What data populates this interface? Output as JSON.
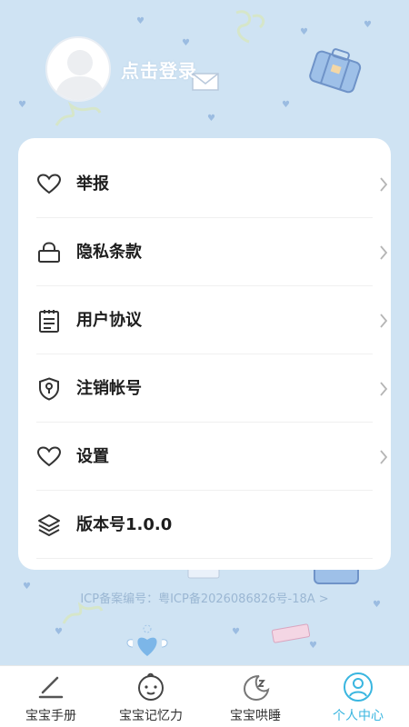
{
  "header": {
    "login_text": "点击登录"
  },
  "menu": {
    "items": [
      {
        "label": "举报",
        "icon": "heart-icon",
        "chevron": true
      },
      {
        "label": "隐私条款",
        "icon": "lock-icon",
        "chevron": true
      },
      {
        "label": "用户协议",
        "icon": "clipboard-icon",
        "chevron": true
      },
      {
        "label": "注销帐号",
        "icon": "shield-icon",
        "chevron": true
      },
      {
        "label": "设置",
        "icon": "heart-icon",
        "chevron": true
      },
      {
        "label": "版本号1.0.0",
        "icon": "layers-icon",
        "chevron": false
      }
    ]
  },
  "footer": {
    "icp": "ICP备案编号：粤ICP备2026086826号-18A >"
  },
  "tabbar": {
    "tabs": [
      {
        "label": "宝宝手册",
        "icon": "pen-icon",
        "active": false
      },
      {
        "label": "宝宝记忆力",
        "icon": "baby-face-icon",
        "active": false
      },
      {
        "label": "宝宝哄睡",
        "icon": "moon-icon",
        "active": false
      },
      {
        "label": "个人中心",
        "icon": "person-icon",
        "active": true
      }
    ]
  },
  "colors": {
    "background": "#cfe3f3",
    "card": "#ffffff",
    "accent": "#3ab6e0",
    "icp_text": "#9bb7d3"
  }
}
